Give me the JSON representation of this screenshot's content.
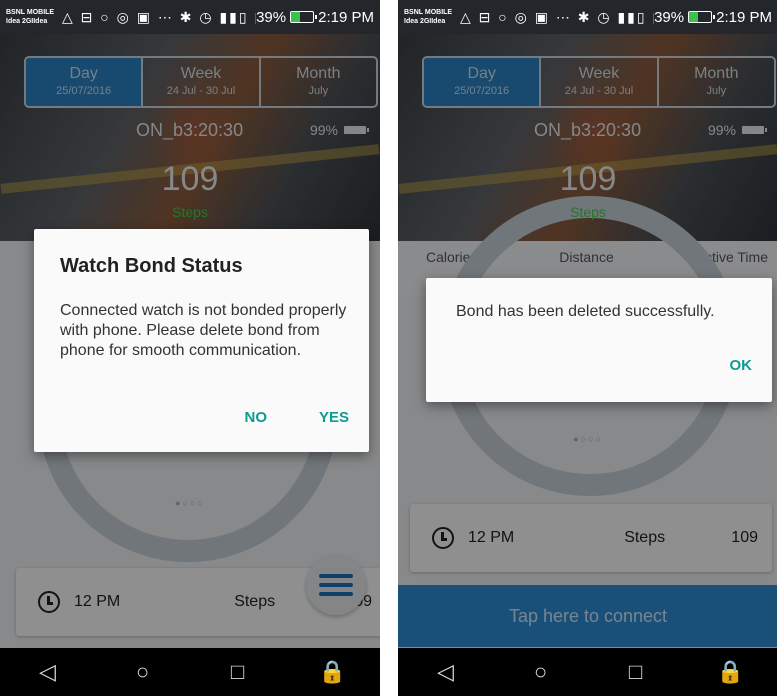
{
  "status_bar": {
    "carrier_line1": "BSNL MOBILE",
    "carrier_line2": "Idea 2GIIdea",
    "icons": "△ ⊟ ○ ◎ ▣ ⋯ ✱ ◷ ▮▮▯ ▮▮▯",
    "battery_percent": "39%",
    "time": "2:19 PM"
  },
  "tabs": [
    {
      "label": "Day",
      "sub": "25/07/2016"
    },
    {
      "label": "Week",
      "sub": "24 Jul - 30 Jul"
    },
    {
      "label": "Month",
      "sub": "July"
    }
  ],
  "device": {
    "name": "ON_b3:20:30",
    "battery": "99%"
  },
  "steps": {
    "count": "109",
    "label": "Steps"
  },
  "stats": {
    "calories": "Calories",
    "distance": "Distance",
    "active_time": "Active Time"
  },
  "hour_card": {
    "time": "12 PM",
    "label": "Steps",
    "value": "109"
  },
  "page_dots": "●○○○",
  "connect_bar": "Tap here to connect",
  "dialog_bond_status": {
    "title": "Watch Bond Status",
    "message": "Connected watch is not bonded properly with phone. Please delete bond from phone for smooth communication.",
    "no": "NO",
    "yes": "YES"
  },
  "dialog_bond_deleted": {
    "message": "Bond has been deleted successfully.",
    "ok": "OK"
  },
  "nav": {
    "back": "◁",
    "home": "○",
    "recents": "□",
    "lock": "🔒"
  }
}
